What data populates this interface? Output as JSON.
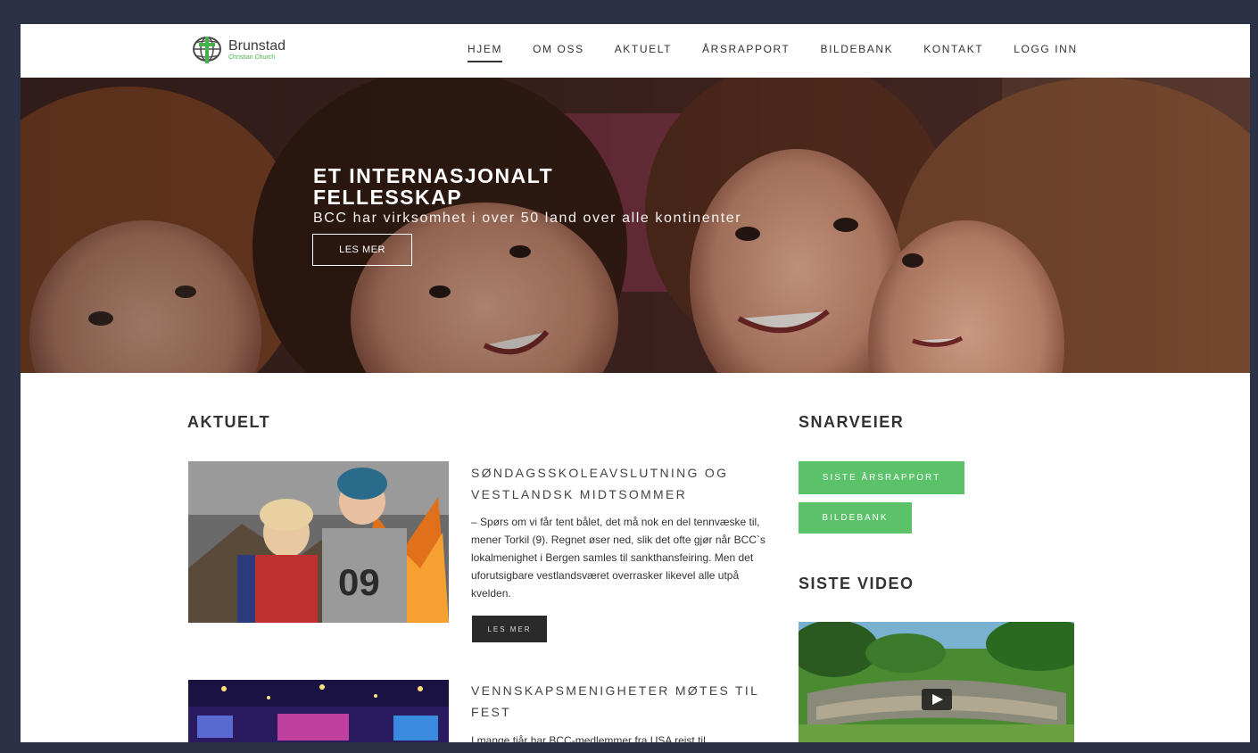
{
  "brand": {
    "name": "Brunstad",
    "subtitle": "Christian Church",
    "logo_icon": "globe-cross-logo"
  },
  "nav": {
    "items": [
      {
        "label": "HJEM",
        "active": true
      },
      {
        "label": "OM OSS",
        "active": false
      },
      {
        "label": "AKTUELT",
        "active": false
      },
      {
        "label": "ÅRSRAPPORT",
        "active": false
      },
      {
        "label": "BILDEBANK",
        "active": false
      },
      {
        "label": "KONTAKT",
        "active": false
      },
      {
        "label": "LOGG INN",
        "active": false
      }
    ]
  },
  "hero": {
    "title": "ET INTERNASJONALT FELLESSKAP",
    "subtitle": "BCC har virksomhet i over 50 land over alle kontinenter",
    "button": "LES MER"
  },
  "news": {
    "heading": "AKTUELT",
    "articles": [
      {
        "title": "SØNDAGSSKOLEAVSLUTNING OG VESTLANDSK MIDTSOMMER",
        "text": "– Spørs om vi får tent bålet, det må nok en del tennvæske til, mener Torkil (9). Regnet øser ned, slik det ofte gjør når BCC`s lokalmenighet i Bergen samles til sankthansfeiring. Men det uforutsigbare vestlandsværet overrasker likevel alle utpå kvelden.",
        "button": "LES MER"
      },
      {
        "title": "VENNSKAPSMENIGHETER MØTES TIL FEST",
        "text": "I mange tiår har BCC-medlemmer fra USA reist til"
      }
    ]
  },
  "shortcuts": {
    "heading": "SNARVEIER",
    "buttons": [
      "SISTE ÅRSRAPPORT",
      "BILDEBANK"
    ]
  },
  "video": {
    "heading": "SISTE VIDEO",
    "play_icon": "play-icon"
  },
  "colors": {
    "frame": "#2b3147",
    "accent_green": "#5cc26a",
    "dark_button": "#2a2a2a"
  }
}
